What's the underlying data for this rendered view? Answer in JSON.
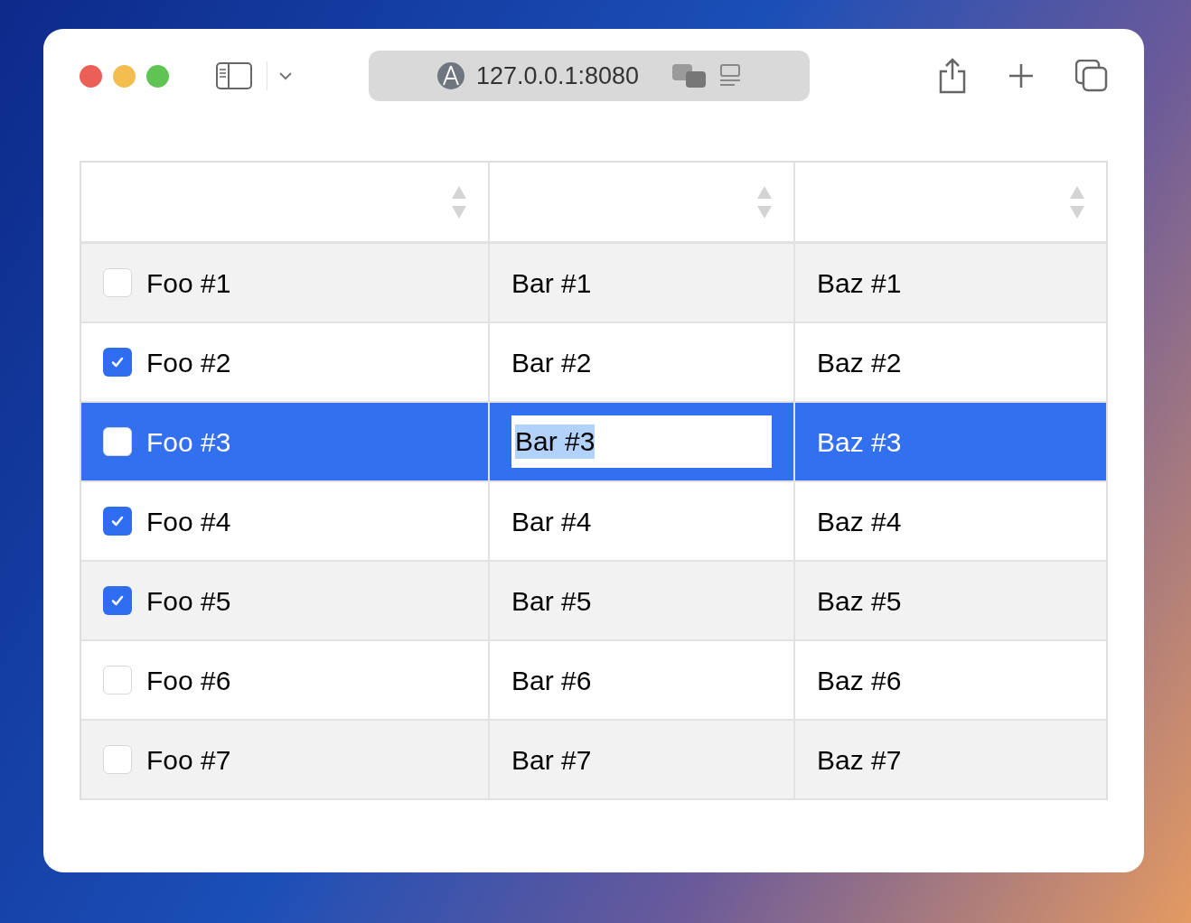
{
  "browser": {
    "address": "127.0.0.1:8080"
  },
  "table": {
    "rows": [
      {
        "selected": false,
        "checked": false,
        "cells": [
          {
            "text": "Foo #1",
            "editing": false
          },
          {
            "text": "Bar #1",
            "editing": false
          },
          {
            "text": "Baz #1",
            "editing": false
          }
        ]
      },
      {
        "selected": false,
        "checked": true,
        "cells": [
          {
            "text": "Foo #2",
            "editing": false
          },
          {
            "text": "Bar #2",
            "editing": false
          },
          {
            "text": "Baz #2",
            "editing": false
          }
        ]
      },
      {
        "selected": true,
        "checked": false,
        "cells": [
          {
            "text": "Foo #3",
            "editing": false
          },
          {
            "text": "Bar #3",
            "editing": true
          },
          {
            "text": "Baz #3",
            "editing": false
          }
        ]
      },
      {
        "selected": false,
        "checked": true,
        "cells": [
          {
            "text": "Foo #4",
            "editing": false
          },
          {
            "text": "Bar #4",
            "editing": false
          },
          {
            "text": "Baz #4",
            "editing": false
          }
        ]
      },
      {
        "selected": false,
        "checked": true,
        "cells": [
          {
            "text": "Foo #5",
            "editing": false
          },
          {
            "text": "Bar #5",
            "editing": false
          },
          {
            "text": "Baz #5",
            "editing": false
          }
        ]
      },
      {
        "selected": false,
        "checked": false,
        "cells": [
          {
            "text": "Foo #6",
            "editing": false
          },
          {
            "text": "Bar #6",
            "editing": false
          },
          {
            "text": "Baz #6",
            "editing": false
          }
        ]
      },
      {
        "selected": false,
        "checked": false,
        "cells": [
          {
            "text": "Foo #7",
            "editing": false
          },
          {
            "text": "Bar #7",
            "editing": false
          },
          {
            "text": "Baz #7",
            "editing": false
          }
        ]
      }
    ]
  }
}
